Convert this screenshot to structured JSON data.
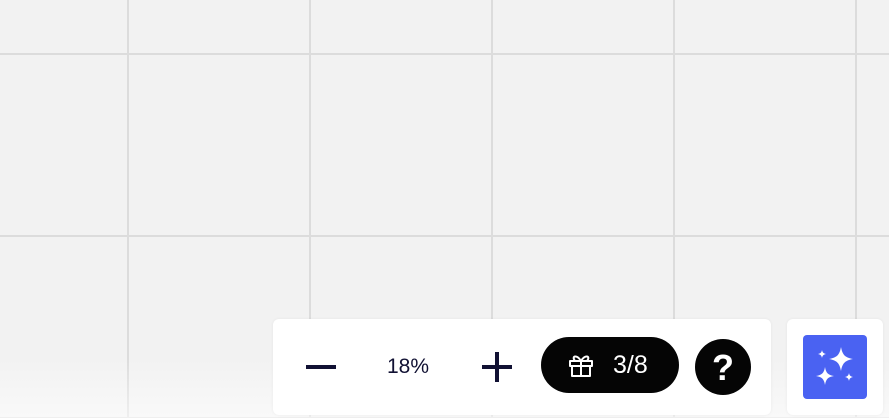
{
  "zoom": {
    "level_text": "18%",
    "zoom_out_icon": "minus-icon",
    "zoom_in_icon": "plus-icon"
  },
  "gift": {
    "icon": "gift-icon",
    "count_text": "3/8"
  },
  "help": {
    "icon": "question-icon",
    "label": "?"
  },
  "assistant": {
    "icon": "sparkles-icon",
    "accent_color": "#4a62f2"
  },
  "colors": {
    "canvas_background": "#f2f2f2",
    "grid_line": "#dcdcdc",
    "toolbar_background": "#ffffff",
    "pill_background": "#050505"
  }
}
